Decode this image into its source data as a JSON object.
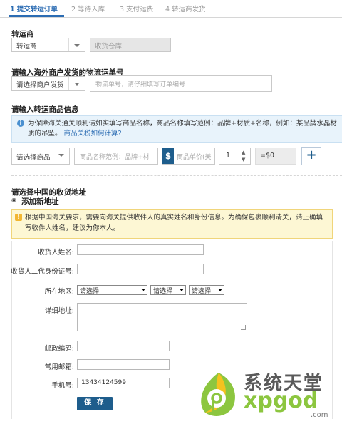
{
  "steps": [
    {
      "label": "1 提交转运订单",
      "active": true
    },
    {
      "label": "2 等待入库",
      "active": false
    },
    {
      "label": "3 支付运费",
      "active": false
    },
    {
      "label": "4 转运商发货",
      "active": false
    }
  ],
  "forwarder": {
    "title": "转运商",
    "select_value": "转运商",
    "warehouse_value": "收货仓库"
  },
  "tracking": {
    "title": "请输入海外商户发货的物流运单号",
    "merchant_select": "请选择商户发货",
    "number_placeholder": "物流单号，请仔细填写订单编号"
  },
  "goods": {
    "title": "请输入转运商品信息",
    "notice": "为保障海关通关顺利请如实填写商品名称，商品名称填写范例：品牌+材质+名称，例如：某品牌水晶材质的吊坠。",
    "notice_link": "商品关税如何计算?",
    "category_select": "请选择商品",
    "name_placeholder": "商品名称范例：品牌+材",
    "price_symbol": "$",
    "price_placeholder": "商品单价(美",
    "quantity": "1",
    "subtotal": "=$0",
    "add_label": "+"
  },
  "address": {
    "title": "请选择中国的收货地址",
    "add_new": "添加新地址",
    "warning": "根据中国海关要求，需要向海关提供收件人的真实姓名和身份信息。为确保包裹顺利清关，请正确填写收件人姓名，建议为你本人。",
    "labels": {
      "name": "收货人姓名:",
      "id_number": "收货人二代身份证号:",
      "region": "所在地区:",
      "detail": "详细地址:",
      "zip": "邮政编码:",
      "email": "常用邮箱:",
      "phone": "手机号:"
    },
    "values": {
      "name": "",
      "id_number": "",
      "detail": "",
      "zip": "",
      "email": "",
      "phone": "13434124599"
    },
    "province": "请选择",
    "city": "请选择",
    "district": "请选择",
    "save_label": "保 存"
  },
  "watermark": {
    "brand_cn": "系统天堂",
    "brand_en": "xpgod",
    "tld": ".com"
  }
}
